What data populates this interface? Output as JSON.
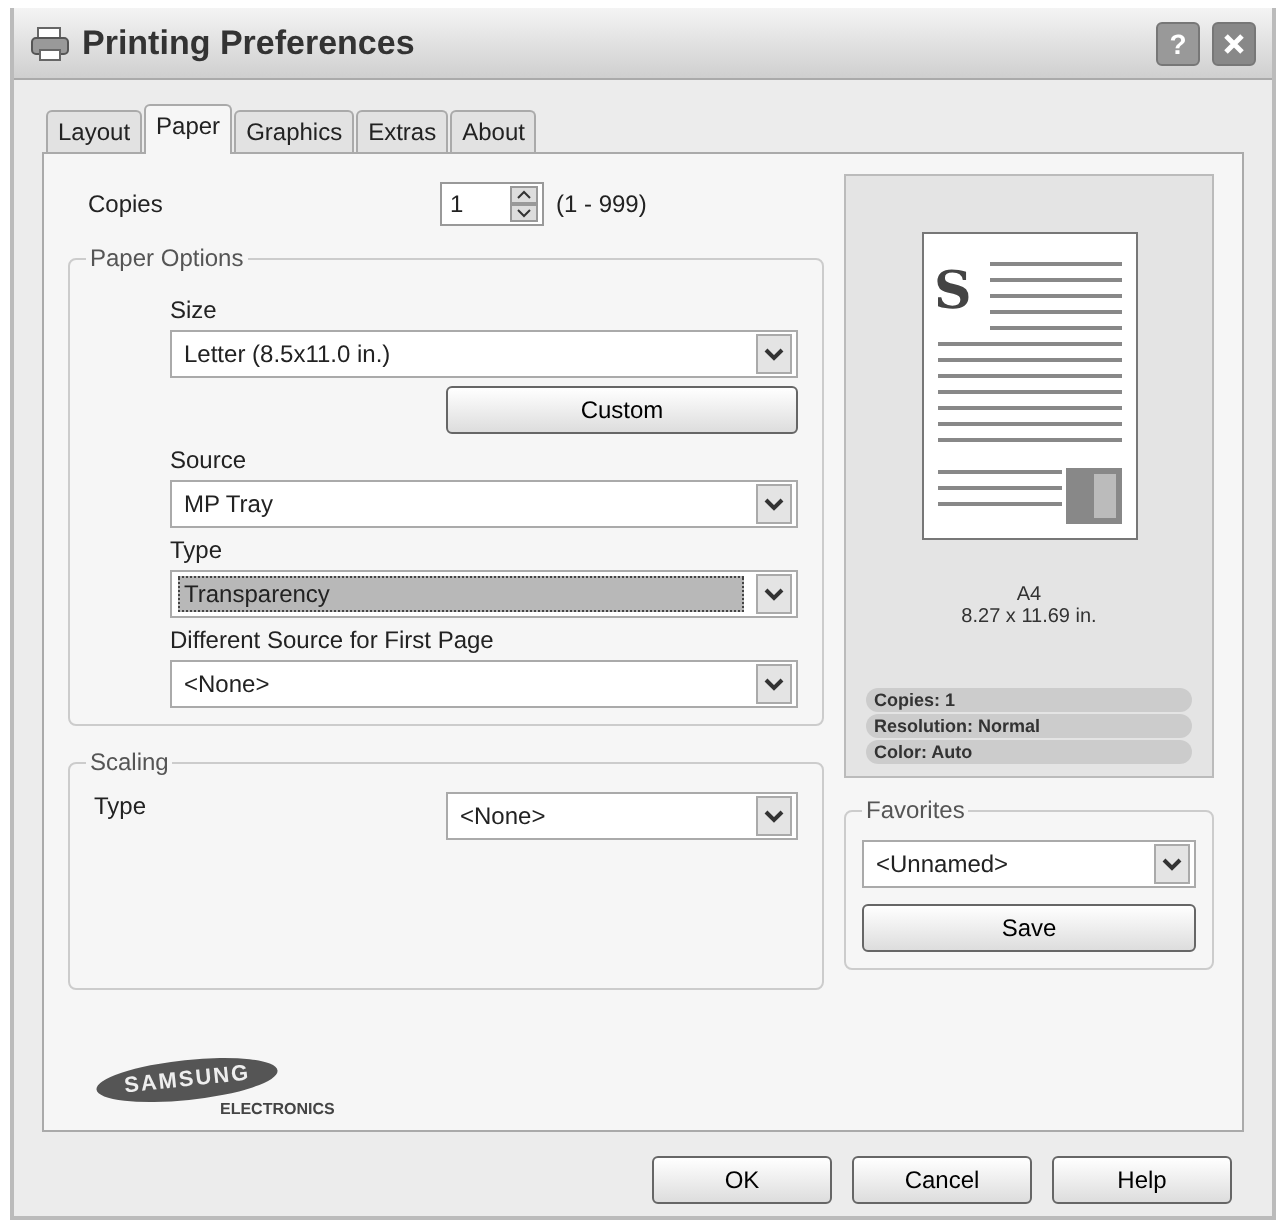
{
  "window": {
    "title": "Printing Preferences",
    "help_label": "?"
  },
  "tabs": [
    {
      "label": "Layout",
      "selected": false
    },
    {
      "label": "Paper",
      "selected": true
    },
    {
      "label": "Graphics",
      "selected": false
    },
    {
      "label": "Extras",
      "selected": false
    },
    {
      "label": "About",
      "selected": false
    }
  ],
  "copies": {
    "label": "Copies",
    "value": "1",
    "range": "(1 - 999)"
  },
  "paper_options": {
    "title": "Paper Options",
    "fields": [
      {
        "kind": "select",
        "label": "Size",
        "value": "Letter (8.5x11.0 in.)",
        "focused": false
      },
      {
        "kind": "button",
        "label": "Custom"
      },
      {
        "kind": "select",
        "label": "Source",
        "value": "MP Tray",
        "focused": false
      },
      {
        "kind": "select",
        "label": "Type",
        "value": "Transparency",
        "focused": true
      },
      {
        "kind": "select",
        "label": "Different Source for First Page",
        "value": "<None>",
        "focused": false
      }
    ]
  },
  "scaling": {
    "title": "Scaling",
    "label": "Type",
    "value": "<None>"
  },
  "preview": {
    "page_initial": "S",
    "paper_name": "A4",
    "paper_size": "8.27 x 11.69 in.",
    "summary": [
      "Copies: 1",
      "Resolution: Normal",
      "Color: Auto"
    ]
  },
  "favorites": {
    "title": "Favorites",
    "value": "<Unnamed>",
    "button": "Save"
  },
  "logo": {
    "brand": "SAMSUNG",
    "subtitle": "ELECTRONICS"
  },
  "buttons": [
    "OK",
    "Cancel",
    "Help"
  ]
}
